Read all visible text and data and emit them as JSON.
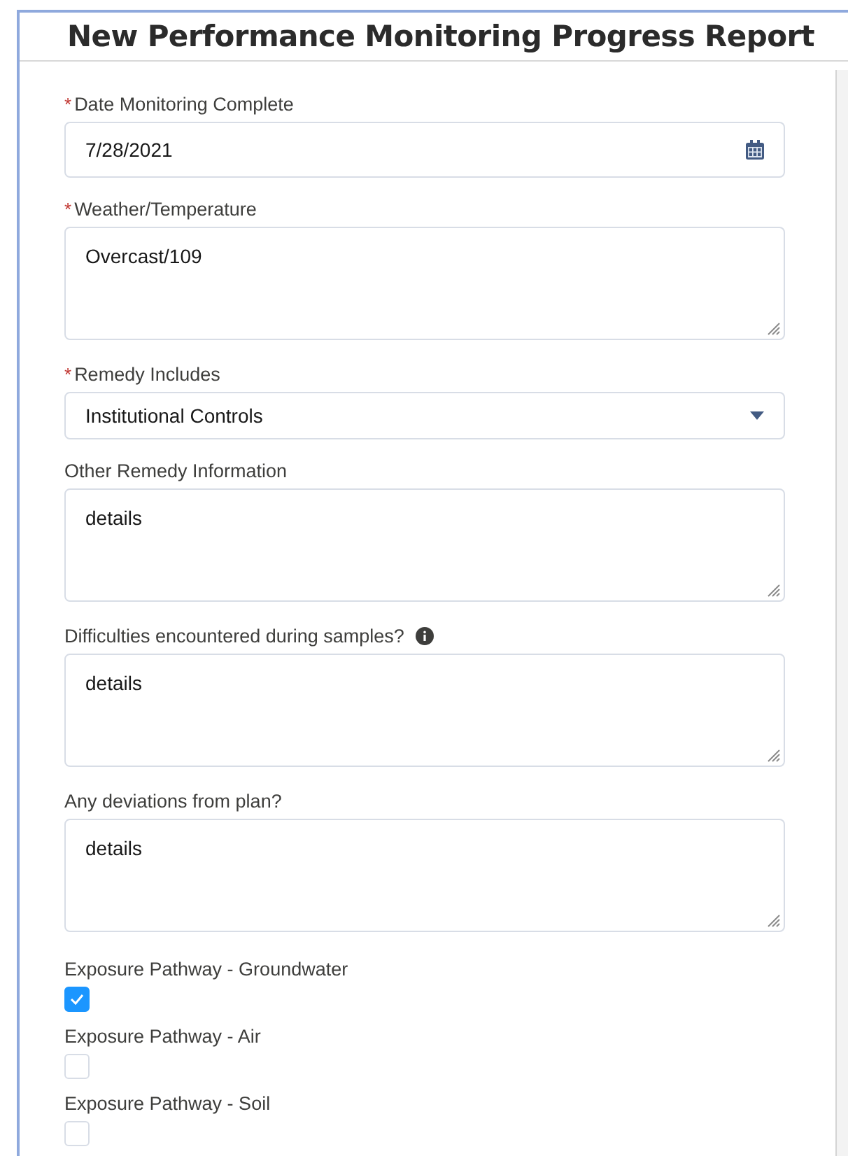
{
  "title": "New Performance Monitoring Progress Report",
  "fields": [
    {
      "kind": "date",
      "label": "Date Monitoring Complete",
      "required_mark": "*",
      "value": "7/28/2021"
    },
    {
      "kind": "textarea",
      "label": "Weather/Temperature",
      "required_mark": "*",
      "value": "Overcast/109"
    },
    {
      "kind": "select",
      "label": "Remedy Includes",
      "required_mark": "*",
      "value": "Institutional Controls"
    },
    {
      "kind": "textarea",
      "label": "Other Remedy Information",
      "value": "details"
    },
    {
      "kind": "textarea",
      "label": "Difficulties encountered during samples?",
      "info": true,
      "value": "details"
    },
    {
      "kind": "textarea",
      "label": "Any deviations from plan?",
      "value": "details"
    },
    {
      "kind": "checkbox",
      "label": "Exposure Pathway - Groundwater",
      "checked": true
    },
    {
      "kind": "checkbox",
      "label": "Exposure Pathway - Air",
      "checked": false
    },
    {
      "kind": "checkbox",
      "label": "Exposure Pathway - Soil",
      "checked": false
    }
  ]
}
